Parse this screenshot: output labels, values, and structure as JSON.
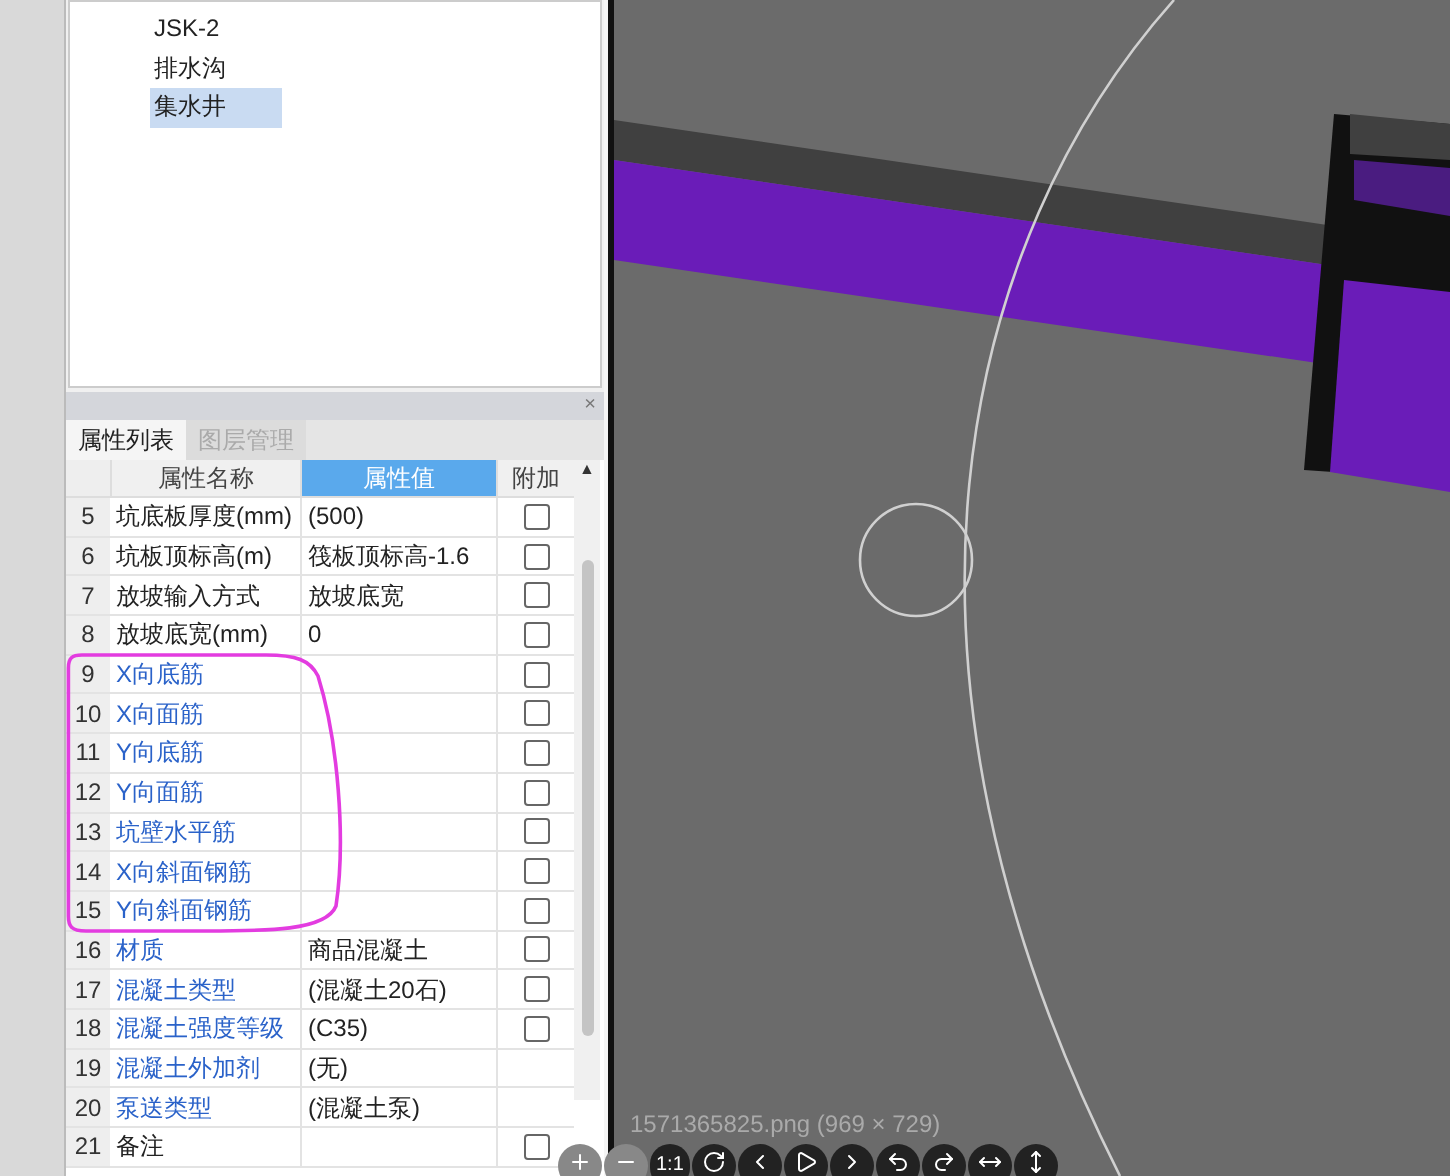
{
  "component_list": {
    "items": [
      {
        "label": "JSK-2",
        "selected": false
      },
      {
        "label": "排水沟",
        "selected": false
      },
      {
        "label": "集水井",
        "selected": true
      }
    ]
  },
  "panel": {
    "close": "×",
    "tabs": [
      {
        "label": "属性列表",
        "selected": true
      },
      {
        "label": "图层管理",
        "selected": false
      }
    ]
  },
  "table": {
    "columns": [
      {
        "label": "属性名称",
        "selected": false
      },
      {
        "label": "属性值",
        "selected": true
      },
      {
        "label": "附加",
        "selected": false
      }
    ],
    "rows": [
      {
        "num": "5",
        "name": "坑底板厚度(mm)",
        "value": "(500)",
        "link": false,
        "kind": "checkbox",
        "checked": false
      },
      {
        "num": "6",
        "name": "坑板顶标高(m)",
        "value": "筏板顶标高-1.6",
        "link": false,
        "kind": "checkbox",
        "checked": false
      },
      {
        "num": "7",
        "name": "放坡输入方式",
        "value": "放坡底宽",
        "link": false,
        "kind": "checkbox",
        "checked": false
      },
      {
        "num": "8",
        "name": "放坡底宽(mm)",
        "value": "0",
        "link": false,
        "kind": "checkbox",
        "checked": false
      },
      {
        "num": "9",
        "name": "X向底筋",
        "link": true,
        "kind": "checkbox",
        "checked": false
      },
      {
        "num": "10",
        "name": "X向面筋",
        "link": true,
        "kind": "checkbox",
        "checked": false
      },
      {
        "num": "11",
        "name": "Y向底筋",
        "link": true,
        "kind": "checkbox",
        "checked": false
      },
      {
        "num": "12",
        "name": "Y向面筋",
        "link": true,
        "kind": "checkbox",
        "checked": false
      },
      {
        "num": "13",
        "name": "坑壁水平筋",
        "link": true,
        "kind": "checkbox",
        "checked": false
      },
      {
        "num": "14",
        "name": "X向斜面钢筋",
        "link": true,
        "kind": "checkbox",
        "checked": false
      },
      {
        "num": "15",
        "name": "Y向斜面钢筋",
        "link": true,
        "kind": "checkbox",
        "checked": false
      },
      {
        "num": "16",
        "name": "材质",
        "value": "商品混凝土",
        "link": true,
        "kind": "checkbox",
        "checked": false
      },
      {
        "num": "17",
        "name": "混凝土类型",
        "value": "(混凝土20石)",
        "link": true,
        "kind": "checkbox",
        "checked": false
      },
      {
        "num": "18",
        "name": "混凝土强度等级",
        "value": "(C35)",
        "link": true,
        "kind": "checkbox",
        "checked": false
      },
      {
        "num": "19",
        "name": "混凝土外加剂",
        "value": "(无)",
        "link": true,
        "kind": "none"
      },
      {
        "num": "20",
        "name": "泵送类型",
        "value": "(混凝土泵)",
        "link": true,
        "kind": "none"
      },
      {
        "num": "21",
        "name": "备注",
        "link": false,
        "kind": "checkbox",
        "checked": false
      }
    ]
  },
  "scroll_up": "▲",
  "viewer": {
    "caption": "1571365825.png (969 × 729)",
    "zoom_label": "1:1"
  }
}
